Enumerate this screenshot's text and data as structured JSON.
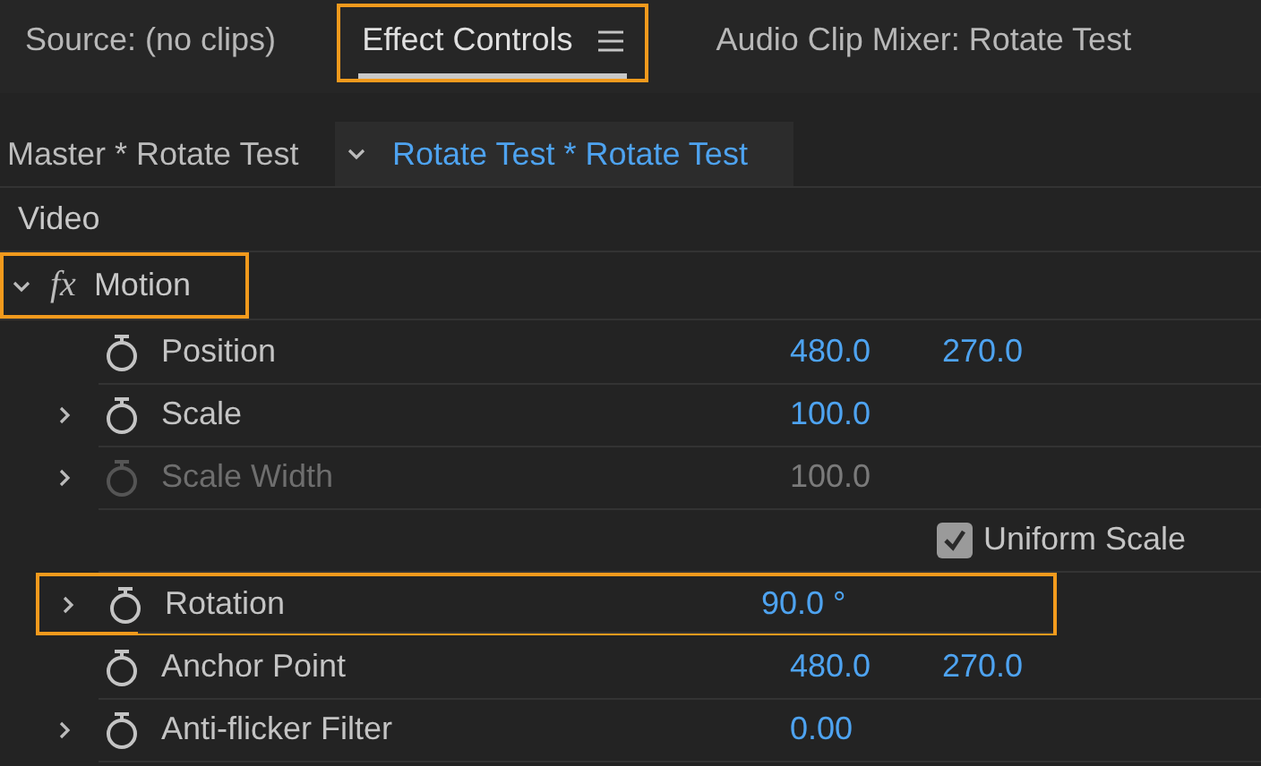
{
  "tabs": [
    {
      "label": "Source: (no clips)",
      "selected": false,
      "highlighted": false,
      "has_menu": false
    },
    {
      "label": "Effect Controls",
      "selected": true,
      "highlighted": true,
      "has_menu": true
    },
    {
      "label": "Audio Clip Mixer: Rotate Test",
      "selected": false,
      "highlighted": false,
      "has_menu": false
    }
  ],
  "clip_bar": {
    "master": "Master * Rotate Test",
    "clip": "Rotate Test * Rotate Test"
  },
  "section": "Video",
  "effect": {
    "badge": "fx",
    "name": "Motion",
    "expanded": true,
    "highlighted": true,
    "properties": [
      {
        "kind": "property",
        "name": "Position",
        "expandable": false,
        "disabled": false,
        "highlighted": false,
        "values": [
          "480.0",
          "270.0"
        ]
      },
      {
        "kind": "property",
        "name": "Scale",
        "expandable": true,
        "disabled": false,
        "highlighted": false,
        "values": [
          "100.0"
        ]
      },
      {
        "kind": "property",
        "name": "Scale Width",
        "expandable": true,
        "disabled": true,
        "highlighted": false,
        "values": [
          "100.0"
        ]
      },
      {
        "kind": "checkbox",
        "label": "Uniform Scale",
        "checked": true
      },
      {
        "kind": "property",
        "name": "Rotation",
        "expandable": true,
        "disabled": false,
        "highlighted": true,
        "values": [
          "90.0 °"
        ]
      },
      {
        "kind": "property",
        "name": "Anchor Point",
        "expandable": false,
        "disabled": false,
        "highlighted": false,
        "values": [
          "480.0",
          "270.0"
        ]
      },
      {
        "kind": "property",
        "name": "Anti-flicker Filter",
        "expandable": true,
        "disabled": false,
        "highlighted": false,
        "values": [
          "0.00"
        ]
      }
    ]
  }
}
